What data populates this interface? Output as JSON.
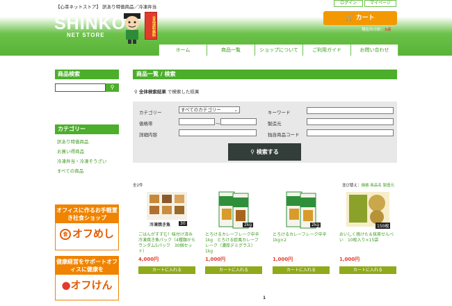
{
  "header": {
    "tagline": "【心幸ネットストア】 訳あり特価商品／冷凍弁当",
    "logo": "SHINKO",
    "logo_sub": "NET STORE",
    "stamp": "全品送料無料",
    "login": "ログイン",
    "mypage": "マイページ",
    "cart_label": "カート",
    "cart_prefix": "現在の小計：",
    "cart_count": "1点"
  },
  "nav": [
    "ホーム",
    "商品一覧",
    "ショップについて",
    "ご利用ガイド",
    "お問い合わせ"
  ],
  "sidebar": {
    "search_title": "商品検索",
    "category_title": "カテゴリー",
    "categories": [
      "訳あり特価商品",
      "お買い得商品",
      "冷凍弁当・冷凍そうざい",
      "すべての商品"
    ],
    "banner1_top": "オフィスに作るお手軽置き社食ショップ",
    "banner1_logo": "オフめし",
    "banner2_top": "健康経営をサポートオフィスに健康を",
    "banner2_logo": "オフけん"
  },
  "main": {
    "title": "商品一覧 / 検索",
    "result_bold": "全体検索結果",
    "result_rest": " で検索した結果",
    "form": {
      "category_label": "カテゴリー",
      "category_value": "すべてのカテゴリー",
      "price_label": "価格帯",
      "price_sep": "〜",
      "detail_label": "詳細内容",
      "keyword_label": "キーワード",
      "maker_label": "製造元",
      "code_label": "独自商品コード",
      "search_button": "検索する"
    },
    "count": "全2件",
    "sort_prefix": "並び替え：",
    "sort_options": [
      "価格",
      "商品名",
      "製造元"
    ]
  },
  "products": [
    {
      "name": "ごはんがすすむ！味付け済み冷凍焼き魚パック（4種類からランダム5パック　30個セット）",
      "price": "4,000円",
      "cart": "カートに入れる",
      "img_label": "冷凍焼き魚",
      "badge": "30",
      "colors": {
        "bg": "#ffffff",
        "accent": "#c48a3a"
      }
    },
    {
      "name": "とろけるカレーフレーク中辛1kg　とろける欧風カレーフレーク（濃厚デミグラス）1kg",
      "price": "1,000円",
      "cart": "カートに入れる",
      "img_label": "カレーフレーク",
      "badge": "2kg",
      "colors": {
        "bg": "#ffffff",
        "accent": "#2f8f3a"
      }
    },
    {
      "name": "とろけるカレーフレーク中辛1kg×2",
      "price": "1,000円",
      "cart": "カートに入れる",
      "img_label": "カレーフレーク",
      "badge": "2kg",
      "colors": {
        "bg": "#ffffff",
        "accent": "#2f8f3a"
      }
    },
    {
      "name": "おいしく焼けた＆抹茶せんべい　10枚入り×15袋",
      "price": "1,000円",
      "cart": "カートに入れる",
      "img_label": "抹茶せんべい",
      "badge": "150枚",
      "colors": {
        "bg": "#ffffff",
        "accent": "#8aa12a"
      }
    }
  ],
  "pager": "1"
}
